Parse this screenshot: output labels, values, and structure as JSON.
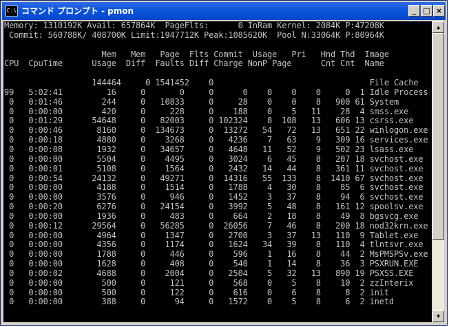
{
  "window": {
    "title": "コマンド プロンプト - pmon",
    "icon_text": "C:\\",
    "buttons": {
      "minimize": "_",
      "maximize": "□",
      "close": "×"
    }
  },
  "scrollbar": {
    "up": "▲",
    "down": "▼",
    "position_fraction": 0.0
  },
  "console": {
    "lines": [
      "Memory: 1310192K Avail: 657864K  PageFlts:      0 InRam Kernel: 2084K P:47208K",
      " Commit: 560788K/ 408700K Limit:1947712K Peak:1085620K  Pool N:33064K P:80964K",
      "",
      "                    Mem   Mem   Page  Flts Commit  Usage   Pri   Hnd Thd  Image",
      "CPU  CpuTime      Usage  Diff  Faults Diff Charge NonP Page      Cnt Cnt  Name",
      "",
      "                  144464     0 1541452    0                                File Cache",
      "99   5:02:41         16     0       0     0      0    0    0    0     0  1 Idle Process",
      " 0   0:01:46        244     0   10833     0     28    0    0    8   900 61 System",
      " 0   0:00:00        420     0     228     0    188    0    5   11    28  4 smss.exe",
      " 0   0:01:29      54648     0   82003     0 102324    8  108   13   606 13 csrss.exe",
      " 0   0:00:46       8160     0  134673     0  13272   54   72   13   651 22 winlogon.exe",
      " 0   0:00:18       4880     0    3268     0   4236    7   63    9   309 16 services.exe",
      " 0   0:00:08       1932     0   34657     0   4648   11   52    9   502 23 lsass.exe",
      " 0   0:00:00       5504     0    4495     0   3024    6   45    8   207 18 svchost.exe",
      " 0   0:00:01       5108     0    1564     0   2432   14   44    8   361 11 svchost.exe",
      " 0   0:00:54      24132     0   49271     0  14316   55  133    8  1410 67 svchost.exe",
      " 0   0:00:00       4188     0    1514     0   1788    4   30    8    85  6 svchost.exe",
      " 0   0:00:00       3576     0     946     0   1452    3   37    8    94  6 svchost.exe",
      " 0   0:00:20       6276     0   24154     0   3992    5   48    8   161 12 spoolsv.exe",
      " 0   0:00:00       1936     0     483     0    664    2   18    8    49  8 bgsvcg.exe",
      " 0   0:00:12      29564     0   56285     0  26056    7   46    8   200 18 nod32krn.exe",
      " 0   0:00:00       4964     0    1347     0   2700    3   37   13   110  9 Tablet.exe",
      " 0   0:00:00       4356     0    1174     0   1624   34   39    8   110  4 tlntsvr.exe",
      " 0   0:00:00       1788     0     446     0    596    1   16    8    44  2 MsPMSPSv.exe",
      " 0   0:00:00       1628     0     408     0    540    1   14    8    36  3 PSXRUN.EXE",
      " 0   0:00:02       4688     0    2004     0   2504    5   32   13   890 19 PSXSS.EXE",
      " 0   0:00:00        500     0     121     0    568    0    5    8    10  2 zzInterix",
      " 0   0:00:00        500     0     122     0    616    0    6    8     8  2 init",
      " 0   0:00:00        388     0      94     0   1572    0    5    8     6  2 inetd"
    ]
  }
}
